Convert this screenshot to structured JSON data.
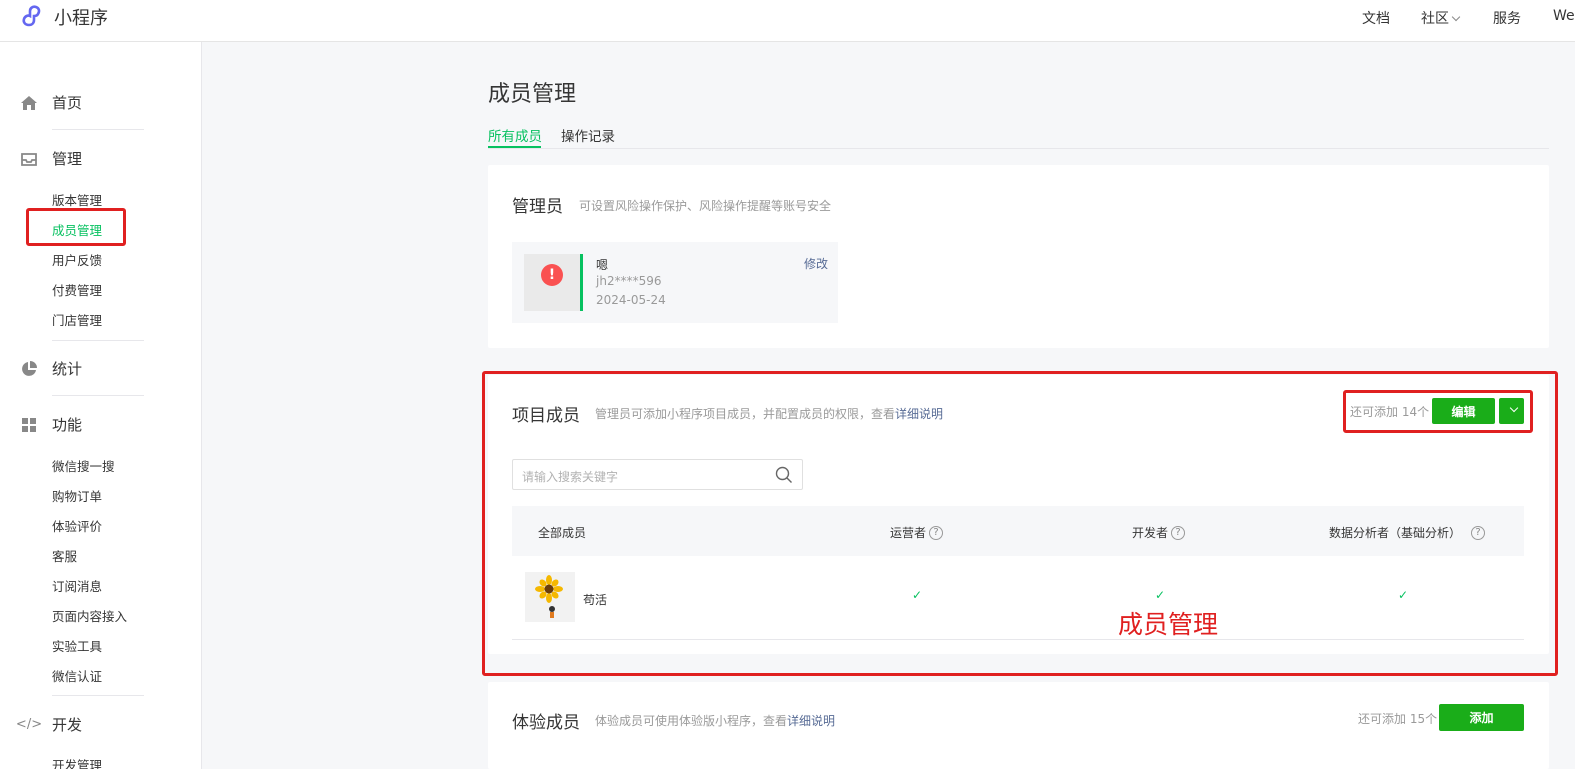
{
  "app": {
    "name": "小程序"
  },
  "topnav": {
    "docs": "文档",
    "community": "社区",
    "service": "服务",
    "user_partial": "We"
  },
  "sidebar": {
    "home": "首页",
    "manage": "管理",
    "manage_items": [
      "版本管理",
      "成员管理",
      "用户反馈",
      "付费管理",
      "门店管理"
    ],
    "stats": "统计",
    "features": "功能",
    "feature_items": [
      "微信搜一搜",
      "购物订单",
      "体验评价",
      "客服",
      "订阅消息",
      "页面内容接入",
      "实验工具",
      "微信认证"
    ],
    "dev": "开发",
    "dev_items": [
      "开发管理"
    ]
  },
  "page": {
    "title": "成员管理",
    "tabs": [
      "所有成员",
      "操作记录"
    ]
  },
  "admin": {
    "title": "管理员",
    "subtitle": "可设置风险操作保护、风险操作提醒等账号安全",
    "name": "嗯",
    "id": "jh2****596",
    "date": "2024-05-24",
    "edit": "修改"
  },
  "project": {
    "title": "项目成员",
    "subtitle": "管理员可添加小程序项目成员，并配置成员的权限，查看",
    "subtitle_link": "详细说明",
    "remaining": "还可添加 14个",
    "edit_button": "编辑",
    "search_placeholder": "请输入搜索关键字",
    "columns": [
      "全部成员",
      "运营者",
      "开发者",
      "数据分析者（基础分析）"
    ],
    "rows": [
      {
        "name": "苟活",
        "operator": "✓",
        "developer": "✓",
        "analyst": "✓"
      }
    ]
  },
  "trial": {
    "title": "体验成员",
    "subtitle": "体验成员可使用体验版小程序，查看",
    "subtitle_link": "详细说明",
    "remaining": "还可添加 15个",
    "add_button": "添加"
  },
  "annotation": {
    "label": "成员管理"
  },
  "colors": {
    "accent": "#07c160",
    "button": "#1aad19",
    "annotation": "#e02020",
    "link": "#576b95"
  }
}
